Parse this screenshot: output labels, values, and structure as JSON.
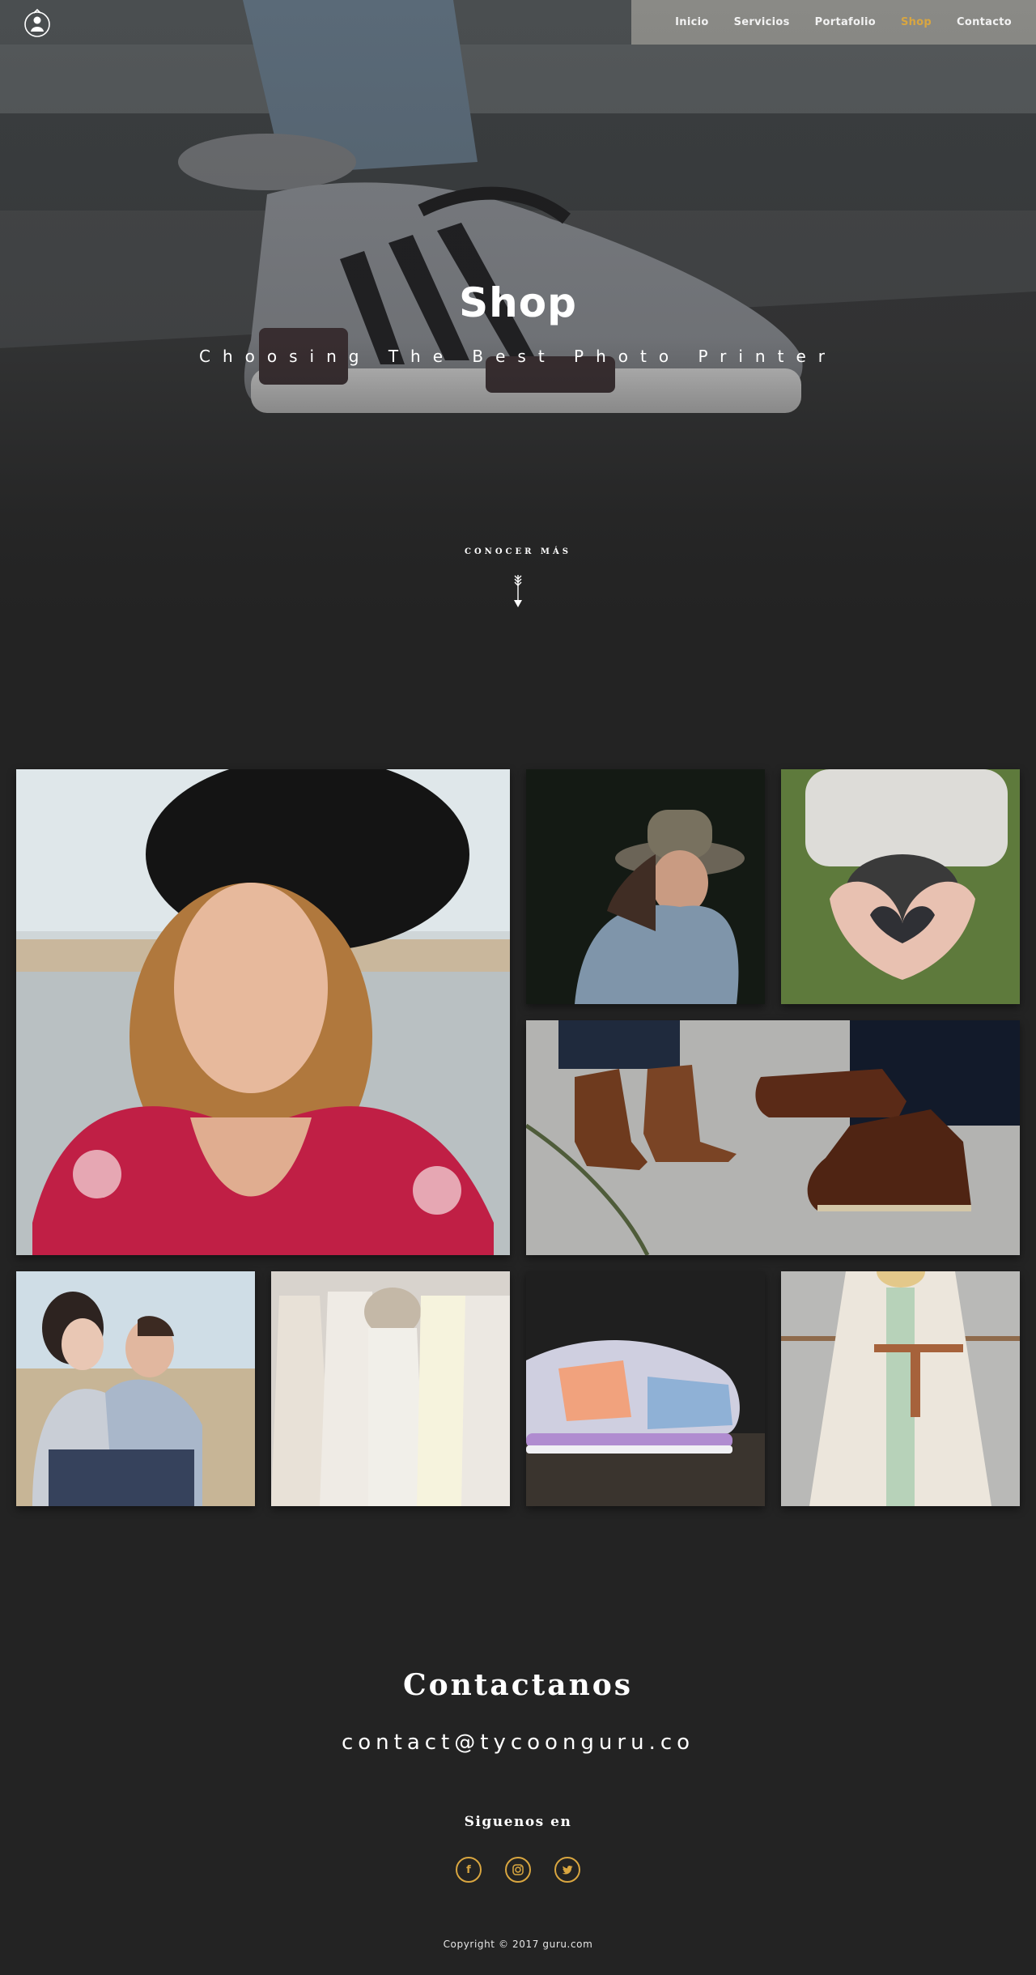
{
  "nav": {
    "logo": "tycoon-guru-logo",
    "items": [
      {
        "label": "Inicio",
        "active": false
      },
      {
        "label": "Servicios",
        "active": false
      },
      {
        "label": "Portafolio",
        "active": false
      },
      {
        "label": "Shop",
        "active": true
      },
      {
        "label": "Contacto",
        "active": false
      }
    ]
  },
  "hero": {
    "title": "Shop",
    "subtitle": "Choosing The Best Photo Printer",
    "more_label": "CONOCER MÁS",
    "scroll_icon": "arrow-down-icon"
  },
  "gallery": {
    "images": [
      {
        "name": "woman-black-hat-photo"
      },
      {
        "name": "woman-fedora-photo"
      },
      {
        "name": "hands-heart-photo"
      },
      {
        "name": "brown-boots-photo"
      },
      {
        "name": "couple-laughing-photo"
      },
      {
        "name": "white-dresses-photo"
      },
      {
        "name": "sneakers-photo"
      },
      {
        "name": "white-coat-photo"
      }
    ]
  },
  "contact": {
    "title": "Contactanos",
    "email": "contact@tycoonguru.co",
    "follow_title": "Siguenos en",
    "social": [
      {
        "icon": "facebook-icon",
        "glyph": "f"
      },
      {
        "icon": "instagram-icon",
        "glyph": ""
      },
      {
        "icon": "twitter-icon",
        "glyph": ""
      }
    ]
  },
  "footer": {
    "copyright": "Copyright © 2017 guru.com"
  },
  "colors": {
    "background": "#232323",
    "accent": "#d9a640",
    "text": "#ffffff"
  }
}
